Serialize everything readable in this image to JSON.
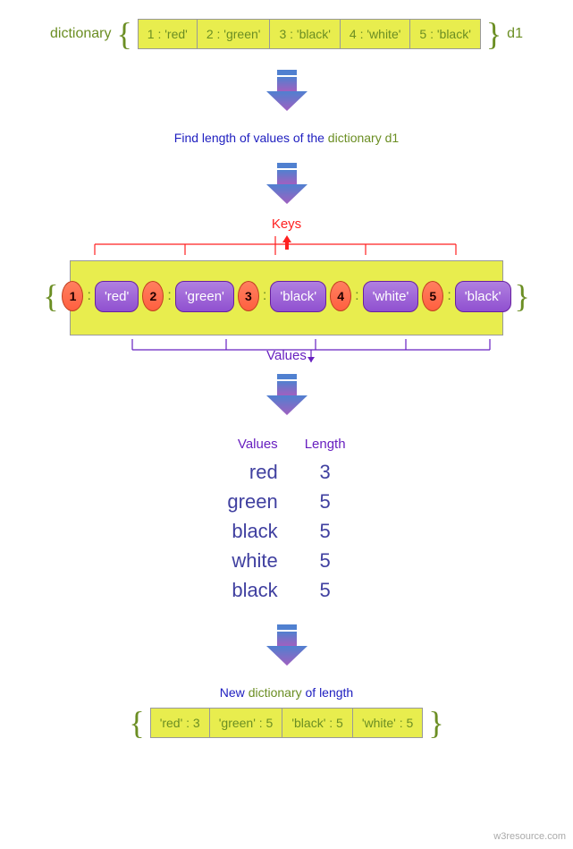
{
  "labels": {
    "dictionary": "dictionary",
    "d1": "d1",
    "instruction_prefix": "Find length of values of the ",
    "instruction_dict": "dictionary ",
    "instruction_suffix": "d1",
    "keys": "Keys",
    "values": "Values",
    "length": "Length",
    "new_dict_prefix": "New ",
    "new_dict_mid": "dictionary",
    "new_dict_suffix": " of length",
    "watermark": "w3resource.com"
  },
  "dict1": {
    "cells": [
      "1 : 'red'",
      "2 : 'green'",
      "3 : 'black'",
      "4 : 'white'",
      "5 : 'black'"
    ]
  },
  "kv": {
    "pairs": [
      {
        "k": "1",
        "v": "'red'"
      },
      {
        "k": "2",
        "v": "'green'"
      },
      {
        "k": "3",
        "v": "'black'"
      },
      {
        "k": "4",
        "v": "'white'"
      },
      {
        "k": "5",
        "v": "'black'"
      }
    ]
  },
  "table": {
    "values": [
      "red",
      "green",
      "black",
      "white",
      "black"
    ],
    "lengths": [
      "3",
      "5",
      "5",
      "5",
      "5"
    ]
  },
  "result": {
    "cells": [
      "'red' : 3",
      "'green' : 5",
      "'black' : 5",
      "'white' : 5"
    ]
  }
}
